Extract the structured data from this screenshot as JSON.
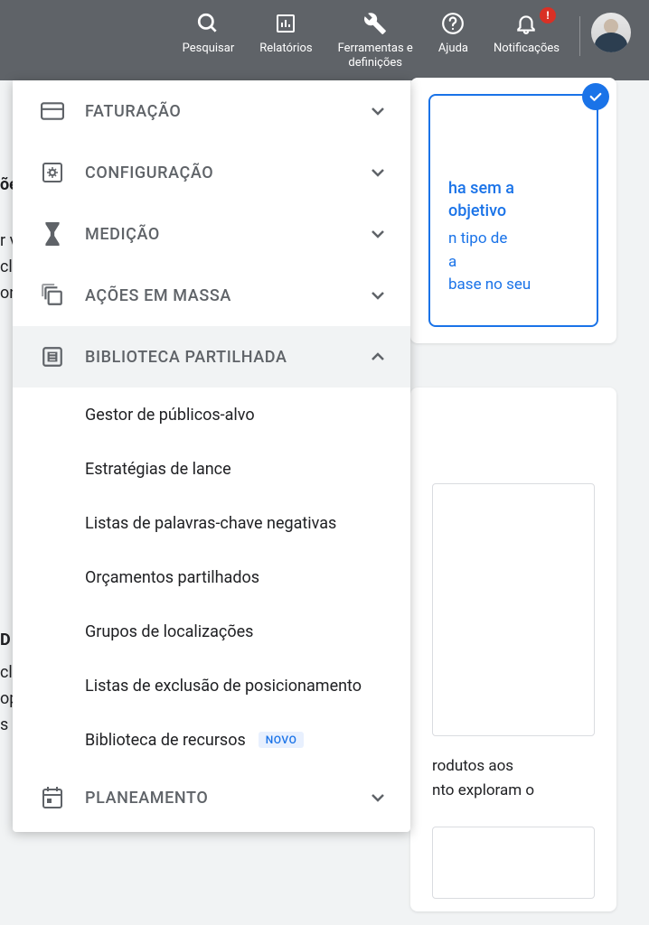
{
  "topbar": {
    "search": "Pesquisar",
    "reports": "Relatórios",
    "tools": "Ferramentas e\ndefinições",
    "help": "Ajuda",
    "notifications": "Notificações",
    "notif_badge": "!"
  },
  "menu": {
    "billing": "FATURAÇÃO",
    "config": "CONFIGURAÇÃO",
    "measure": "MEDIÇÃO",
    "bulk": "AÇÕES EM MASSA",
    "shared": "BIBLIOTECA PARTILHADA",
    "planning": "PLANEAMENTO"
  },
  "submenu": {
    "audiences": "Gestor de públicos-alvo",
    "bidding": "Estratégias de lance",
    "negkeywords": "Listas de palavras-chave negativas",
    "budgets": "Orçamentos partilhados",
    "locations": "Grupos de localizações",
    "placement": "Listas de exclusão de posicionamento",
    "resources": "Biblioteca de recursos",
    "new_badge": "NOVO"
  },
  "bg": {
    "left1": "õe",
    "left2": "r v",
    "left3": "clu",
    "left4": "on",
    "letterD": "D",
    "l5": "cli",
    "l6": "op",
    "l7": "s",
    "card_top_t1a": "ha sem a",
    "card_top_t1b": "objetivo",
    "card_top_t2a": "n tipo de",
    "card_top_t2b": "a",
    "card_top_t2c": "base no seu",
    "card_mid_t1": "rodutos aos",
    "card_mid_t2": "nto exploram o"
  }
}
